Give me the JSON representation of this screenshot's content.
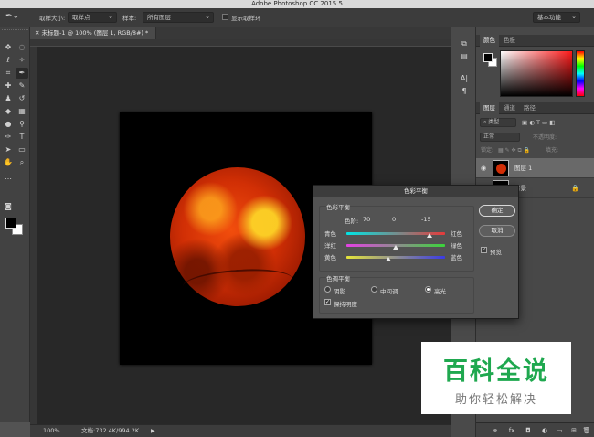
{
  "app": {
    "title": "Adobe Photoshop CC 2015.5"
  },
  "options_bar": {
    "sample_size_label": "取样大小:",
    "sample_size_value": "取样点",
    "sample_label": "样本:",
    "sample_value": "所有图层",
    "show_ring_label": "显示取样环",
    "workspace": "基本功能"
  },
  "document": {
    "tab_title": "未标题-1 @ 100% (图层 1, RGB/8#) *"
  },
  "status": {
    "zoom": "100%",
    "doc_info": "文档:732.4K/994.2K",
    "arrow": "▶"
  },
  "color_panel": {
    "tabs": [
      "颜色",
      "色板"
    ]
  },
  "layers_panel": {
    "tabs": [
      "图层",
      "通道",
      "路径"
    ],
    "filter_kind": "类型",
    "blend_mode": "正常",
    "opacity_label": "不透明度:",
    "lock_label": "锁定:",
    "fill_label": "填充:",
    "layers": [
      {
        "name": "图层 1"
      },
      {
        "name": "背景"
      }
    ]
  },
  "color_balance_dialog": {
    "title": "色彩平衡",
    "group_balance": "色彩平衡",
    "levels_label": "色阶:",
    "levels": [
      "70",
      "0",
      "-15"
    ],
    "sliders": [
      {
        "left": "青色",
        "right": "红色",
        "value": 70
      },
      {
        "left": "洋红",
        "right": "绿色",
        "value": 0
      },
      {
        "left": "黄色",
        "right": "蓝色",
        "value": -15
      }
    ],
    "group_tone": "色调平衡",
    "tones": [
      "阴影",
      "中间调",
      "高光"
    ],
    "selected_tone": "高光",
    "preserve_luminosity": "保持明度",
    "ok": "确定",
    "cancel": "取消",
    "preview": "预览"
  },
  "watermark": {
    "main": "百科全说",
    "sub": "助你轻松解决"
  }
}
